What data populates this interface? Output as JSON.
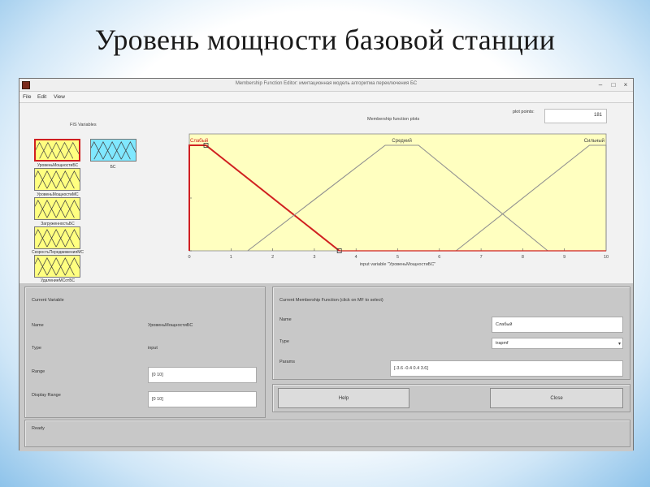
{
  "slide": {
    "title": "Уровень мощности базовой станции"
  },
  "window": {
    "title": "Membership Function Editor: имитационная модель алгоритма переключения БС",
    "minimize": "–",
    "maximize": "□",
    "close": "×"
  },
  "menu": {
    "file": "File",
    "edit": "Edit",
    "view": "View"
  },
  "fis": {
    "label": "FIS Variables",
    "inputs": [
      {
        "name": "УровеньМощностиБС",
        "color": "#ffff80",
        "selected": true
      },
      {
        "name": "УровеньМощностиМС",
        "color": "#ffff80",
        "selected": false
      },
      {
        "name": "ЗагруженностьБС",
        "color": "#ffff80",
        "selected": false
      },
      {
        "name": "СкоростьПередвиженияМС",
        "color": "#ffff80",
        "selected": false
      },
      {
        "name": "УдалениеМСотБС",
        "color": "#ffff80",
        "selected": false
      }
    ],
    "output": {
      "name": "БС",
      "color": "#80e8ff"
    }
  },
  "plot": {
    "title": "Membership function plots",
    "points_label": "plot points:",
    "points_value": "181",
    "xlabel": "input variable \"УровеньМощностиБС\"",
    "xticks": [
      "0",
      "1",
      "2",
      "3",
      "4",
      "5",
      "6",
      "7",
      "8",
      "9",
      "10"
    ],
    "yticks": [
      "0",
      "0.5",
      "1"
    ],
    "selected_color": "#d02020",
    "mf_color": "#909090",
    "background": "#ffffc0"
  },
  "chart_data": {
    "type": "line",
    "title": "Membership function plots",
    "xlabel": "input variable \"УровеньМощностиБС\"",
    "ylabel": "",
    "xlim": [
      0,
      10
    ],
    "ylim": [
      0,
      1
    ],
    "series": [
      {
        "name": "Слабый",
        "x": [
          0,
          0,
          0.4,
          3.6
        ],
        "y": [
          0,
          1,
          1,
          0
        ]
      },
      {
        "name": "Средний",
        "x": [
          1.4,
          4.7,
          5.5,
          8.6
        ],
        "y": [
          0,
          1,
          1,
          0
        ]
      },
      {
        "name": "Сильный",
        "x": [
          6.4,
          9.6,
          10,
          10
        ],
        "y": [
          0,
          1,
          1,
          0
        ]
      }
    ]
  },
  "current_variable": {
    "title": "Current Variable",
    "name_label": "Name",
    "name_value": "УровеньМощностиБС",
    "type_label": "Type",
    "type_value": "input",
    "range_label": "Range",
    "range_value": "[0 10]",
    "display_label": "Display Range",
    "display_value": "[0 10]"
  },
  "current_mf": {
    "title": "Current Membership Function (click on MF to select)",
    "name_label": "Name",
    "name_value": "Слабый",
    "type_label": "Type",
    "type_value": "trapmf",
    "params_label": "Params",
    "params_value": "[-3.6 -0.4 0.4 3.6]"
  },
  "buttons": {
    "help": "Help",
    "close": "Close"
  },
  "status": "Ready"
}
